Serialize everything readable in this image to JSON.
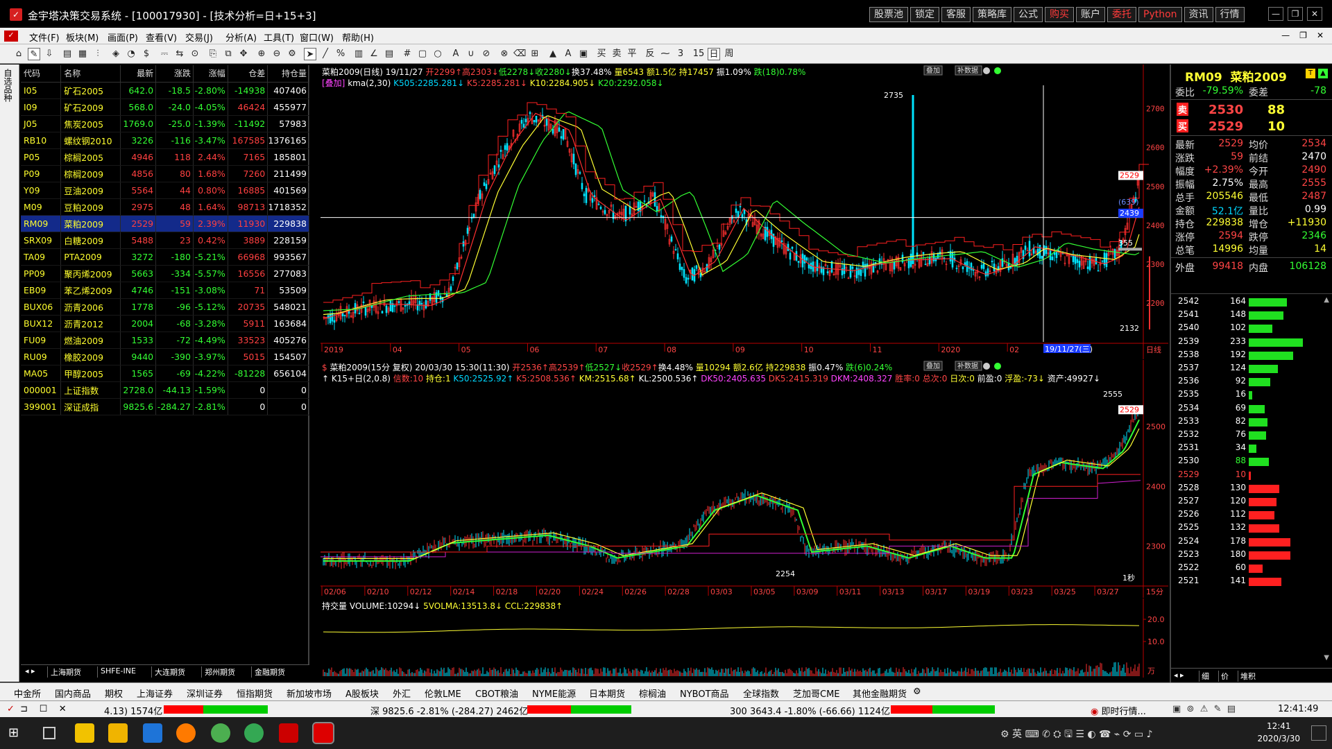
{
  "window": {
    "title": "金宇塔决策交易系统 - [100017930] - [技术分析=日+15+3]",
    "top_buttons": [
      "股票池",
      "锁定",
      "客服",
      "策略库",
      "公式",
      "购买",
      "账户",
      "委托",
      "Python",
      "资讯",
      "行情"
    ],
    "top_buttons_red": [
      "购买",
      "委托",
      "Python"
    ]
  },
  "menu": {
    "items": [
      "文件(F)",
      "板块(M)",
      "画面(P)",
      "查看(V)",
      "交易(J)",
      "分析(A)",
      "工具(T)",
      "窗口(W)",
      "帮助(H)"
    ]
  },
  "left_tab": {
    "label": "自选品种"
  },
  "watchlist": {
    "headers": [
      "代码",
      "名称",
      "最新",
      "涨跌",
      "涨幅",
      "仓差",
      "持仓量"
    ],
    "rows": [
      {
        "code": "I05",
        "name": "矿石2005",
        "last": "642.0",
        "chg": "-18.5",
        "pct": "-2.80%",
        "diff": "-14938",
        "oi": "407406",
        "dir": "dn",
        "ddir": "dn"
      },
      {
        "code": "I09",
        "name": "矿石2009",
        "last": "568.0",
        "chg": "-24.0",
        "pct": "-4.05%",
        "diff": "46424",
        "oi": "455977",
        "dir": "dn",
        "ddir": "up"
      },
      {
        "code": "J05",
        "name": "焦炭2005",
        "last": "1769.0",
        "chg": "-25.0",
        "pct": "-1.39%",
        "diff": "-11492",
        "oi": "57983",
        "dir": "dn",
        "ddir": "dn"
      },
      {
        "code": "RB10",
        "name": "螺纹钢2010",
        "last": "3226",
        "chg": "-116",
        "pct": "-3.47%",
        "diff": "167585",
        "oi": "1376165",
        "dir": "dn",
        "ddir": "up"
      },
      {
        "code": "P05",
        "name": "棕榈2005",
        "last": "4946",
        "chg": "118",
        "pct": "2.44%",
        "diff": "7165",
        "oi": "185801",
        "dir": "up",
        "ddir": "up"
      },
      {
        "code": "P09",
        "name": "棕榈2009",
        "last": "4856",
        "chg": "80",
        "pct": "1.68%",
        "diff": "7260",
        "oi": "211499",
        "dir": "up",
        "ddir": "up"
      },
      {
        "code": "Y09",
        "name": "豆油2009",
        "last": "5564",
        "chg": "44",
        "pct": "0.80%",
        "diff": "16885",
        "oi": "401569",
        "dir": "up",
        "ddir": "up"
      },
      {
        "code": "M09",
        "name": "豆粕2009",
        "last": "2975",
        "chg": "48",
        "pct": "1.64%",
        "diff": "98713",
        "oi": "1718352",
        "dir": "up",
        "ddir": "up"
      },
      {
        "code": "RM09",
        "name": "菜粕2009",
        "last": "2529",
        "chg": "59",
        "pct": "2.39%",
        "diff": "11930",
        "oi": "229838",
        "dir": "up",
        "ddir": "up",
        "selected": true
      },
      {
        "code": "SRX09",
        "name": "白糖2009",
        "last": "5488",
        "chg": "23",
        "pct": "0.42%",
        "diff": "3889",
        "oi": "228159",
        "dir": "up",
        "ddir": "up"
      },
      {
        "code": "TA09",
        "name": "PTA2009",
        "last": "3272",
        "chg": "-180",
        "pct": "-5.21%",
        "diff": "66968",
        "oi": "993567",
        "dir": "dn",
        "ddir": "up"
      },
      {
        "code": "PP09",
        "name": "聚丙烯2009",
        "last": "5663",
        "chg": "-334",
        "pct": "-5.57%",
        "diff": "16556",
        "oi": "277083",
        "dir": "dn",
        "ddir": "up"
      },
      {
        "code": "EB09",
        "name": "苯乙烯2009",
        "last": "4746",
        "chg": "-151",
        "pct": "-3.08%",
        "diff": "71",
        "oi": "53509",
        "dir": "dn",
        "ddir": "up"
      },
      {
        "code": "BUX06",
        "name": "沥青2006",
        "last": "1778",
        "chg": "-96",
        "pct": "-5.12%",
        "diff": "20735",
        "oi": "548021",
        "dir": "dn",
        "ddir": "up"
      },
      {
        "code": "BUX12",
        "name": "沥青2012",
        "last": "2004",
        "chg": "-68",
        "pct": "-3.28%",
        "diff": "5911",
        "oi": "163684",
        "dir": "dn",
        "ddir": "up"
      },
      {
        "code": "FU09",
        "name": "燃油2009",
        "last": "1533",
        "chg": "-72",
        "pct": "-4.49%",
        "diff": "33523",
        "oi": "405276",
        "dir": "dn",
        "ddir": "up"
      },
      {
        "code": "RU09",
        "name": "橡胶2009",
        "last": "9440",
        "chg": "-390",
        "pct": "-3.97%",
        "diff": "5015",
        "oi": "154507",
        "dir": "dn",
        "ddir": "up"
      },
      {
        "code": "MA05",
        "name": "甲醇2005",
        "last": "1565",
        "chg": "-69",
        "pct": "-4.22%",
        "diff": "-81228",
        "oi": "656104",
        "dir": "dn",
        "ddir": "dn"
      },
      {
        "code": "000001",
        "name": "上证指数",
        "last": "2728.0",
        "chg": "-44.13",
        "pct": "-1.59%",
        "diff": "0",
        "oi": "0",
        "dir": "dn",
        "ddir": "wh"
      },
      {
        "code": "399001",
        "name": "深证成指",
        "last": "9825.6",
        "chg": "-284.27",
        "pct": "-2.81%",
        "diff": "0",
        "oi": "0",
        "dir": "dn",
        "ddir": "wh"
      }
    ],
    "bottom_tabs": [
      "上海期货",
      "SHFE-INE",
      "大连期货",
      "郑州期货",
      "金融期货"
    ]
  },
  "daily_panel": {
    "line1": [
      {
        "t": "菜粕2009(日线) 19/11/27 ",
        "c": "w"
      },
      {
        "t": "开2299↑",
        "c": "r"
      },
      {
        "t": "高2303↓",
        "c": "r"
      },
      {
        "t": "低2278↓",
        "c": "g"
      },
      {
        "t": "收2280↓",
        "c": "g"
      },
      {
        "t": "换37.48% ",
        "c": "w"
      },
      {
        "t": "量6543 ",
        "c": "y"
      },
      {
        "t": "额1.5亿 ",
        "c": "y"
      },
      {
        "t": "持17457 ",
        "c": "y"
      },
      {
        "t": "振1.09% ",
        "c": "w"
      },
      {
        "t": "跌(18)0.78%",
        "c": "g"
      }
    ],
    "line2": [
      {
        "t": "[叠加] ",
        "c": "m"
      },
      {
        "t": "kma(2,30) ",
        "c": "w"
      },
      {
        "t": "K505:2285.281↓ ",
        "c": "c"
      },
      {
        "t": "K5:2285.281↓ ",
        "c": "r"
      },
      {
        "t": "K10:2284.905↓ ",
        "c": "y"
      },
      {
        "t": "K20:2292.058↓",
        "c": "g"
      }
    ],
    "price_labels": [
      "2700",
      "2600",
      "2500",
      "2400",
      "2300",
      "2200"
    ],
    "x_labels": [
      "2019",
      "04",
      "05",
      "06",
      "07",
      "08",
      "09",
      "10",
      "11",
      "2020",
      "02",
      "03"
    ],
    "cursor_label": "19/11/27(三)",
    "right_tags": [
      "2529",
      "(639)",
      "2439"
    ],
    "level_355": "355",
    "annotations": {
      "high": "2735",
      "low": "2132"
    },
    "tag_right": "日线",
    "top_buttons": [
      "叠加",
      "补数据"
    ]
  },
  "min15_panel": {
    "line1": [
      {
        "t": "$ ",
        "c": "r"
      },
      {
        "t": "菜粕2009(15分 复权) 20/03/30 15:30(11:30) ",
        "c": "w"
      },
      {
        "t": "开2536↑",
        "c": "r"
      },
      {
        "t": "高2539↑",
        "c": "r"
      },
      {
        "t": "低2527↓",
        "c": "g"
      },
      {
        "t": "收2529↑",
        "c": "r"
      },
      {
        "t": "换4.48% ",
        "c": "w"
      },
      {
        "t": "量10294 ",
        "c": "y"
      },
      {
        "t": "额2.6亿 ",
        "c": "y"
      },
      {
        "t": "持229838 ",
        "c": "y"
      },
      {
        "t": "振0.47% ",
        "c": "w"
      },
      {
        "t": "跌(6)0.24%",
        "c": "g"
      }
    ],
    "line2": [
      {
        "t": "↑ K15+日(2,0.8) ",
        "c": "w"
      },
      {
        "t": "信数:10 ",
        "c": "r"
      },
      {
        "t": "持仓:1 ",
        "c": "y"
      },
      {
        "t": "K50:2525.92↑ ",
        "c": "c"
      },
      {
        "t": "K5:2508.536↑ ",
        "c": "r"
      },
      {
        "t": "KM:2515.68↑ ",
        "c": "y"
      },
      {
        "t": "KL:2500.536↑ ",
        "c": "w"
      },
      {
        "t": "DK50:2405.635 ",
        "c": "m"
      },
      {
        "t": "DK5:2415.319 ",
        "c": "r"
      },
      {
        "t": "DKM:2408.327 ",
        "c": "m"
      },
      {
        "t": "胜率:0 ",
        "c": "r"
      },
      {
        "t": "总次:0 ",
        "c": "r"
      },
      {
        "t": "日次:0 ",
        "c": "y"
      },
      {
        "t": "前盈:0 ",
        "c": "w"
      },
      {
        "t": "浮盈:-73↓ ",
        "c": "y"
      },
      {
        "t": "资产:49927↓",
        "c": "w"
      }
    ],
    "price_labels": [
      "2500",
      "2400",
      "2300"
    ],
    "x_labels": [
      "02/06",
      "02/10",
      "02/12",
      "02/14",
      "02/18",
      "02/20",
      "02/24",
      "02/26",
      "02/28",
      "03/03",
      "03/05",
      "03/09",
      "03/11",
      "03/13",
      "03/17",
      "03/19",
      "03/23",
      "03/25",
      "03/27"
    ],
    "annotations": {
      "high": "2555",
      "low": "2254",
      "tag": "2529",
      "sec": "1秒"
    },
    "tag_right": "15分",
    "top_buttons": [
      "叠加",
      "补数据"
    ]
  },
  "volume_panel": {
    "line": [
      {
        "t": "持交量 ",
        "c": "w"
      },
      {
        "t": "VOLUME:10294↓ ",
        "c": "w"
      },
      {
        "t": "5VOLMA:13513.8↓ ",
        "c": "y"
      },
      {
        "t": "CCL:229838↑",
        "c": "y"
      }
    ],
    "price_labels": [
      "20.0",
      "10.0"
    ],
    "unit": "万"
  },
  "quote_panel": {
    "symbol": "RM09",
    "name": "菜粕2009",
    "webi": {
      "label": "委比",
      "val": "-79.59%",
      "label2": "委差",
      "val2": "-78"
    },
    "sell": {
      "label": "卖",
      "price": "2530",
      "vol": "88"
    },
    "buy": {
      "label": "买",
      "price": "2529",
      "vol": "10"
    },
    "stats": [
      {
        "a": "最新",
        "b": "2529",
        "bc": "r",
        "c": "均价",
        "d": "2534",
        "dc": "r"
      },
      {
        "a": "涨跌",
        "b": "59",
        "bc": "r",
        "c": "前结",
        "d": "2470",
        "dc": "w"
      },
      {
        "a": "幅度",
        "b": "+2.39%",
        "bc": "r",
        "c": "今开",
        "d": "2490",
        "dc": "r"
      },
      {
        "a": "振幅",
        "b": "2.75%",
        "bc": "w",
        "c": "最高",
        "d": "2555",
        "dc": "r"
      },
      {
        "a": "总手",
        "b": "205546",
        "bc": "y",
        "c": "最低",
        "d": "2487",
        "dc": "r"
      },
      {
        "a": "金额",
        "b": "52.1亿",
        "bc": "c",
        "c": "量比",
        "d": "0.99",
        "dc": "w"
      },
      {
        "a": "持仓",
        "b": "229838",
        "bc": "y",
        "c": "增仓",
        "d": "+11930",
        "dc": "y"
      },
      {
        "a": "涨停",
        "b": "2594",
        "bc": "r",
        "c": "跌停",
        "d": "2346",
        "dc": "g"
      },
      {
        "a": "总笔",
        "b": "14996",
        "bc": "y",
        "c": "均量",
        "d": "14",
        "dc": "y"
      }
    ],
    "outer": {
      "a": "外盘",
      "b": "99418",
      "c": "内盘",
      "d": "106128"
    },
    "depth": [
      {
        "p": "2542",
        "v": "164",
        "side": "g"
      },
      {
        "p": "2541",
        "v": "148",
        "side": "g"
      },
      {
        "p": "2540",
        "v": "102",
        "side": "g"
      },
      {
        "p": "2539",
        "v": "233",
        "side": "g"
      },
      {
        "p": "2538",
        "v": "192",
        "side": "g"
      },
      {
        "p": "2537",
        "v": "124",
        "side": "g"
      },
      {
        "p": "2536",
        "v": "92",
        "side": "g"
      },
      {
        "p": "2535",
        "v": "16",
        "side": "g"
      },
      {
        "p": "2534",
        "v": "69",
        "side": "g"
      },
      {
        "p": "2533",
        "v": "82",
        "side": "g"
      },
      {
        "p": "2532",
        "v": "76",
        "side": "g"
      },
      {
        "p": "2531",
        "v": "34",
        "side": "g"
      },
      {
        "p": "2530",
        "v": "88",
        "side": "g"
      },
      {
        "p": "2529",
        "v": "10",
        "side": "r"
      },
      {
        "p": "2528",
        "v": "130",
        "side": "r"
      },
      {
        "p": "2527",
        "v": "120",
        "side": "r"
      },
      {
        "p": "2526",
        "v": "112",
        "side": "r"
      },
      {
        "p": "2525",
        "v": "132",
        "side": "r"
      },
      {
        "p": "2524",
        "v": "178",
        "side": "r"
      },
      {
        "p": "2523",
        "v": "180",
        "side": "r"
      },
      {
        "p": "2522",
        "v": "60",
        "side": "r"
      },
      {
        "p": "2521",
        "v": "141",
        "side": "r"
      }
    ],
    "bottom_tabs": [
      "细",
      "价",
      "堆积"
    ]
  },
  "market_tabs": [
    "中金所",
    "国内商品",
    "期权",
    "上海证券",
    "深圳证券",
    "恒指期货",
    "新加坡市场",
    "A股板块",
    "外汇",
    "伦敦LME",
    "CBOT粮油",
    "NYME能源",
    "日本期货",
    "棕榈油",
    "NYBOT商品",
    "全球指数",
    "芝加哥CME",
    "其他金融期货"
  ],
  "status": {
    "sh": "4.13) 1574亿",
    "sz": "深 9825.6 -2.81% (-284.27) 2462亿",
    "hs300": "300 3643.4 -1.80% (-66.66) 1124亿",
    "right": "即时行情...",
    "time": "12:41:49"
  },
  "taskbar": {
    "time": "12:41",
    "date": "2020/3/30",
    "ime": "英"
  }
}
